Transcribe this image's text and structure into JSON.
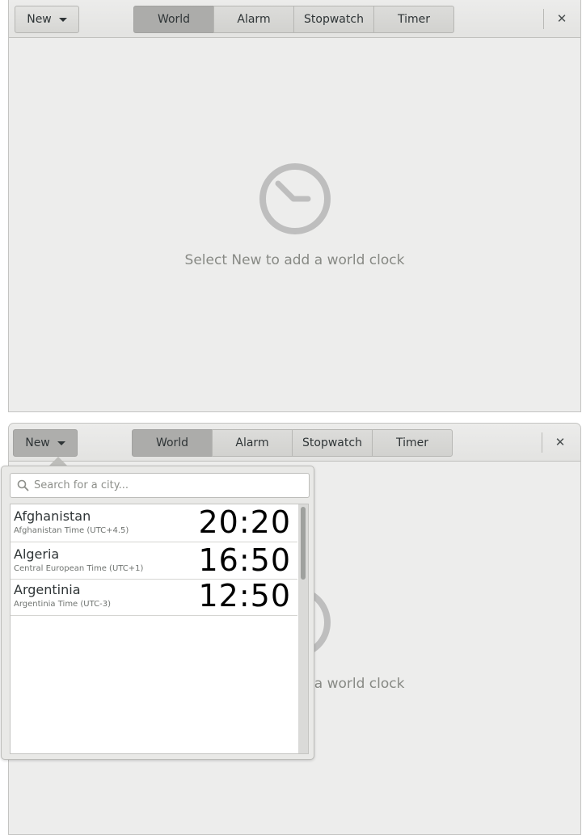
{
  "headerbar": {
    "new_label": "New",
    "tabs": [
      "World",
      "Alarm",
      "Stopwatch",
      "Timer"
    ],
    "active_tab": "World",
    "close_glyph": "✕"
  },
  "empty_state": {
    "message": "Select New to add a world clock",
    "icon": "clock-icon"
  },
  "popover": {
    "search_placeholder": "Search for a city...",
    "cities": [
      {
        "name": "Afghanistan",
        "zone": "Afghanistan Time (UTC+4.5)",
        "time": "20:20"
      },
      {
        "name": "Algeria",
        "zone": "Central European Time (UTC+1)",
        "time": "16:50"
      },
      {
        "name": "Argentinia",
        "zone": "Argentinia Time (UTC-3)",
        "time": "12:50"
      }
    ]
  },
  "colors": {
    "window_bg": "#ededec",
    "active_tab": "#acacaa",
    "icon_gray": "#bebebe"
  }
}
